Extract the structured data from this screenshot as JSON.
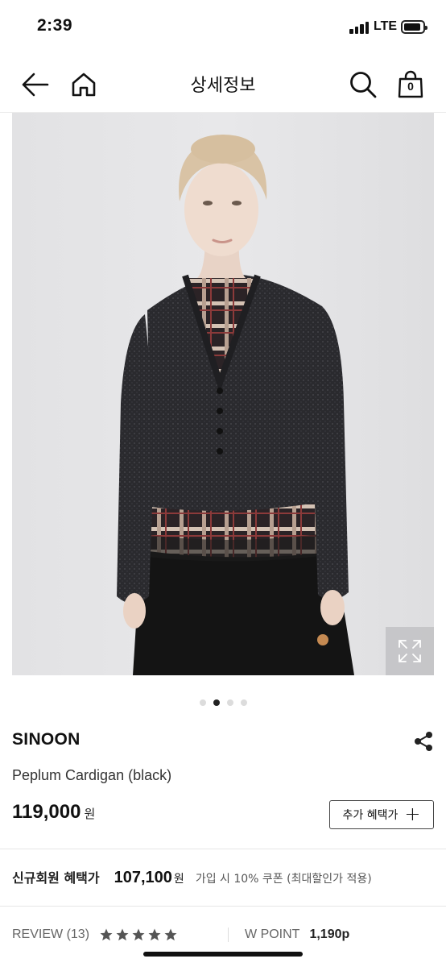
{
  "status_bar": {
    "time": "2:39",
    "network": "LTE"
  },
  "nav": {
    "title": "상세정보",
    "back_icon": "back-arrow-icon",
    "home_icon": "home-icon",
    "search_icon": "search-icon",
    "cart_icon": "shopping-bag-icon",
    "cart_count": "0"
  },
  "gallery": {
    "image_alt": "Model wearing black peplum cardigan over plaid ruffle top",
    "expand_icon": "expand-icon",
    "total_images": 4,
    "active_index": 1
  },
  "product": {
    "brand": "SINOON",
    "share_icon": "share-icon",
    "name": "Peplum Cardigan (black)",
    "price": "119,000",
    "currency": "원",
    "benefit_button_label": "추가 혜택가"
  },
  "member_benefit": {
    "label": "신규회원 혜택가",
    "price": "107,100",
    "currency": "원",
    "note": "가입 시 10% 쿠폰 (최대할인가 적용)"
  },
  "review": {
    "label": "REVIEW (13)",
    "rating": 5,
    "max_rating": 5
  },
  "wpoint": {
    "label": "W POINT",
    "value": "1,190p"
  },
  "colors": {
    "text": "#111111",
    "hero_bg": "#e4e4e6",
    "star": "#555555"
  }
}
